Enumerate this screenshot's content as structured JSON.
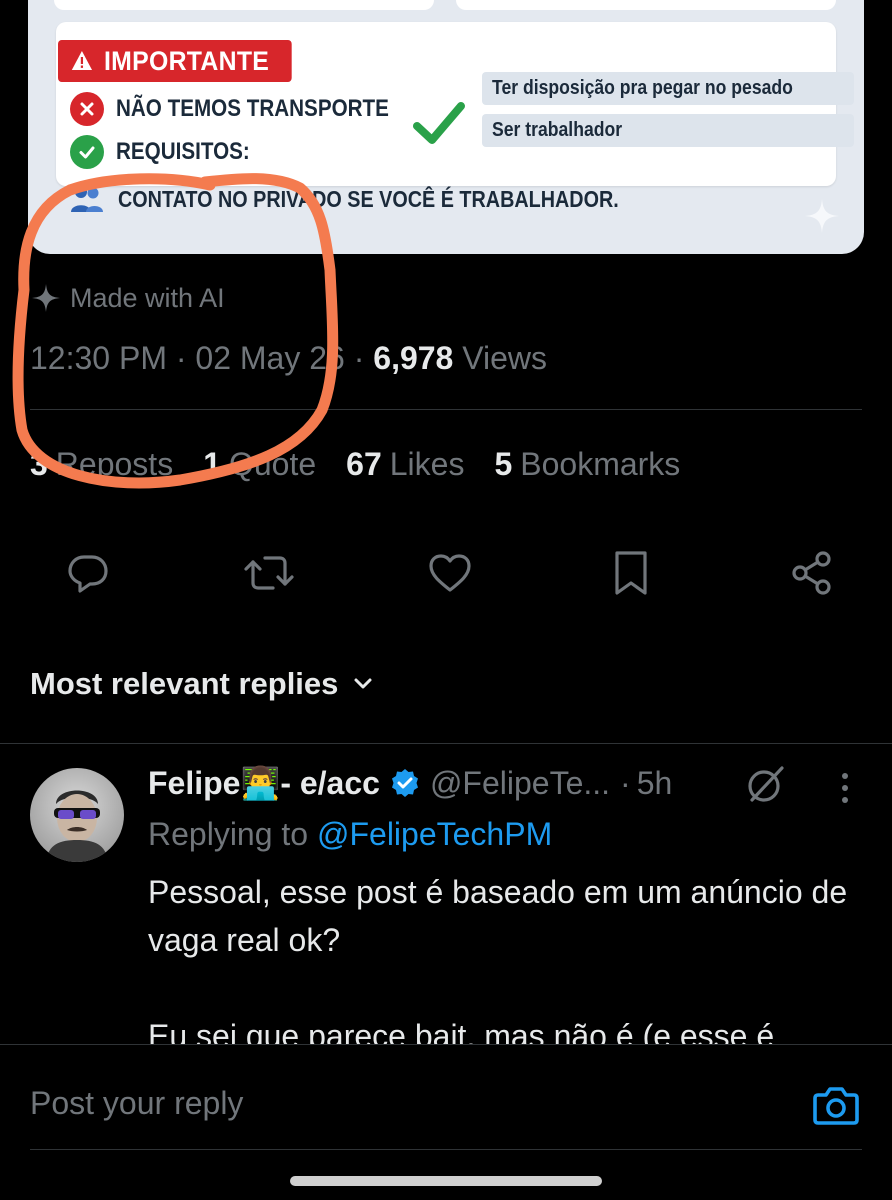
{
  "image_card": {
    "important_label": "IMPORTANTE",
    "no_transport": "NÃO TEMOS TRANSPORTE",
    "requirements_label": "REQUISITOS:",
    "requirements": [
      "Ter disposição pra pegar no pesado",
      "Ser trabalhador"
    ],
    "contact": "CONTATO NO PRIVADO SE VOCÊ É TRABALHADOR.",
    "colors": {
      "warning_red": "#d7262b",
      "check_green": "#2aa149"
    }
  },
  "post_meta": {
    "made_with_ai": "Made with AI",
    "time": "12:30 PM",
    "date": "02 May 26",
    "views_count": "6,978",
    "views_label": "Views"
  },
  "stats": [
    {
      "count": "3",
      "label": "Reposts"
    },
    {
      "count": "1",
      "label": "Quote"
    },
    {
      "count": "67",
      "label": "Likes"
    },
    {
      "count": "5",
      "label": "Bookmarks"
    }
  ],
  "actions": [
    "reply-icon",
    "repost-icon",
    "like-icon",
    "bookmark-icon",
    "share-icon"
  ],
  "replies_sort": {
    "label": "Most relevant replies"
  },
  "reply": {
    "name": "Felipe👨‍💻- e/acc",
    "handle": "@FelipeTe...",
    "time": "5h",
    "replying_prefix": "Replying to",
    "replying_to": "@FelipeTechPM",
    "text_1": "Pessoal, esse post é baseado em um anúncio de vaga real ok?",
    "text_2": "Eu sei que parece bait, mas não é (e esse é"
  },
  "composer": {
    "placeholder": "Post your reply"
  },
  "accent_colors": {
    "link_blue": "#1d9bf0",
    "annotation_orange": "#f47b4f"
  }
}
